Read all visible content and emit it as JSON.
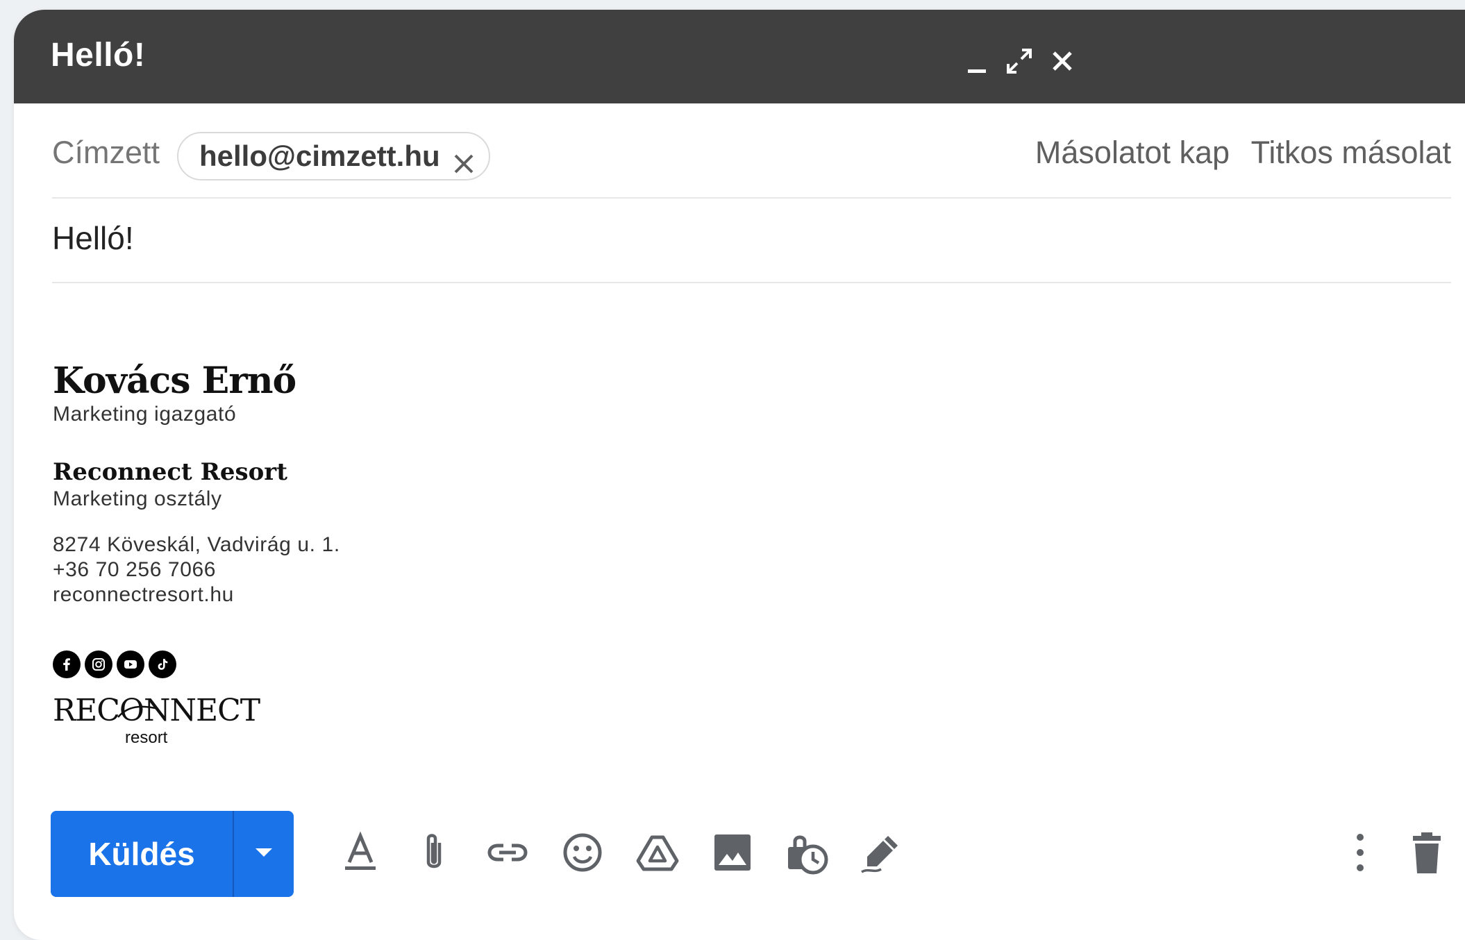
{
  "window": {
    "title": "Helló!",
    "controls": [
      "minimize-icon",
      "expand-icon",
      "close-icon"
    ]
  },
  "recipients": {
    "to_label": "Címzett",
    "to_chip": "hello@cimzett.hu",
    "cc_label": "Másolatot kap",
    "bcc_label": "Titkos másolat"
  },
  "subject": "Helló!",
  "signature": {
    "name": "Kovács Ernő",
    "title": "Marketing igazgató",
    "company": "Reconnect Resort",
    "department": "Marketing osztály",
    "address": "8274 Köveskál, Vadvirág u. 1.",
    "phone": "+36 70 256 7066",
    "website": "reconnectresort.hu",
    "social": [
      "facebook-icon",
      "instagram-icon",
      "youtube-icon",
      "tiktok-icon"
    ],
    "logo_main": "RECONNECT",
    "logo_sub": "resort"
  },
  "toolbar": {
    "send_label": "Küldés",
    "tools": [
      "formatting-icon",
      "attach-icon",
      "link-icon",
      "emoji-icon",
      "drive-icon",
      "photo-icon",
      "confidential-icon",
      "signature-icon",
      "more-options-icon",
      "discard-icon"
    ],
    "accent_color": "#1a73e8"
  }
}
